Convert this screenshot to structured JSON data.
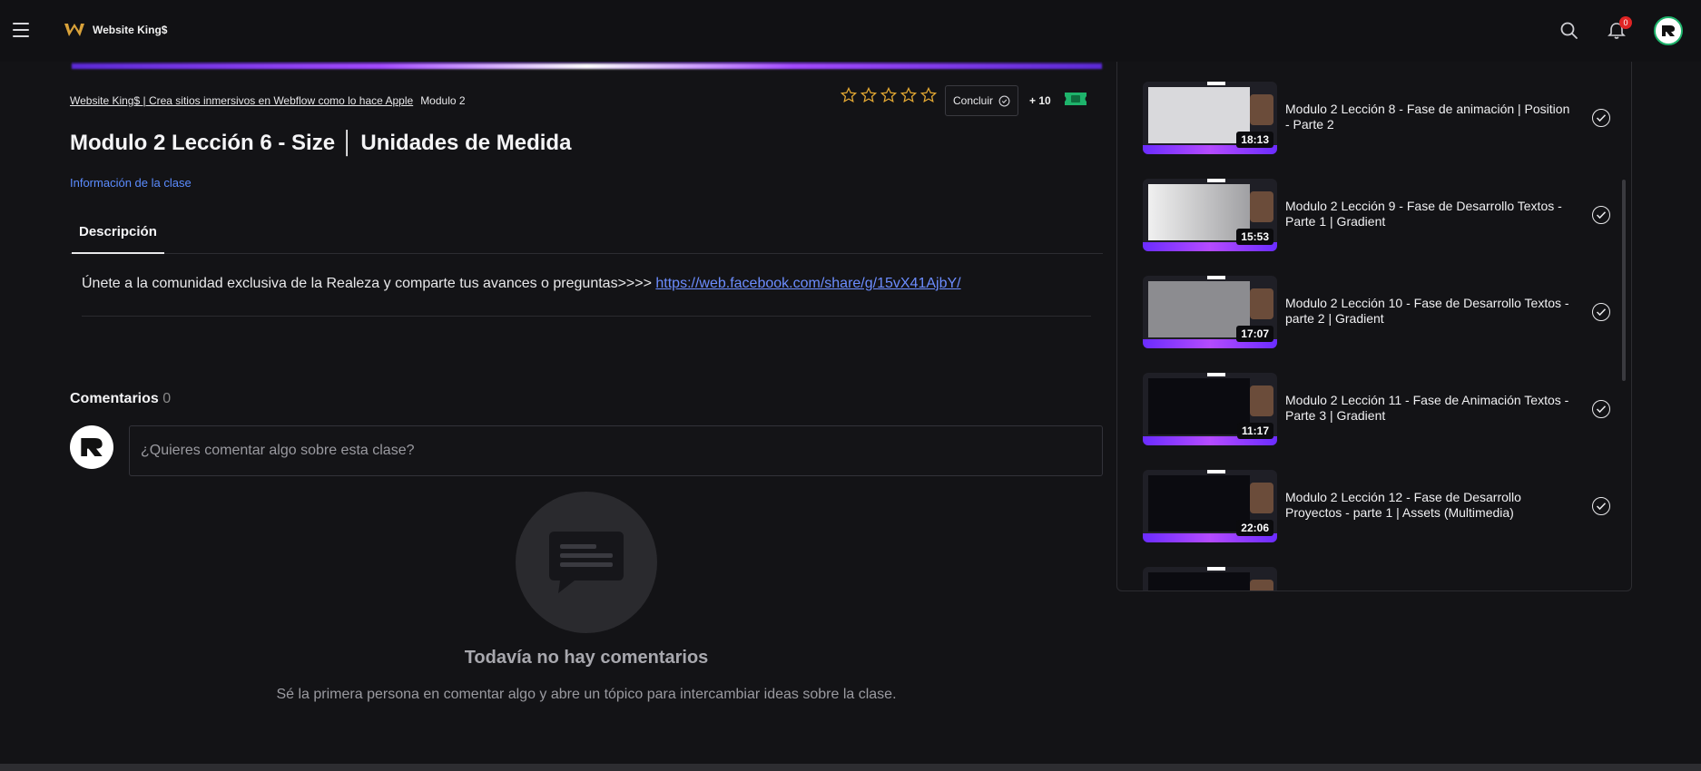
{
  "header": {
    "brand_name": "Website King$",
    "notification_count": "0",
    "icons": [
      "menu-icon",
      "search-icon",
      "bell-icon",
      "avatar"
    ]
  },
  "breadcrumb": {
    "course": "Website King$ | Crea sitios inmersivos en Webflow como lo hace Apple",
    "module": "Modulo 2"
  },
  "rating": {
    "stars": 5,
    "filled": 0
  },
  "actions": {
    "conclude_label": "Concluir",
    "points": "+ 10"
  },
  "lesson": {
    "title": "Modulo 2 Lección 6 - Size │ Unidades de Medida",
    "class_info": "Información de la clase"
  },
  "tabs": {
    "description": "Descripción"
  },
  "description": {
    "text": "Únete a la comunidad exclusiva de la Realeza y comparte tus avances o preguntas>>>> ",
    "link": "https://web.facebook.com/share/g/15vX41AjbY/"
  },
  "comments": {
    "heading": "Comentarios",
    "count": "0",
    "placeholder": "¿Quieres comentar algo sobre esta clase?",
    "empty_title": "Todavía no hay comentarios",
    "empty_subtitle": "Sé la primera persona en comentar algo y abre un tópico para intercambiar ideas sobre la clase."
  },
  "playlist": {
    "items": [
      {
        "title": "Modulo 2 Lección 8 - Fase de animación | Position - Parte 2",
        "duration": "18:13",
        "completed": true
      },
      {
        "title": "Modulo 2 Lección 9 - Fase de Desarrollo Textos - Parte 1 | Gradient",
        "duration": "15:53",
        "completed": true
      },
      {
        "title": "Modulo 2 Lección 10 - Fase de Desarrollo Textos - parte 2 | Gradient",
        "duration": "17:07",
        "completed": true
      },
      {
        "title": "Modulo 2 Lección 11 - Fase de Animación Textos - Parte 3 | Gradient",
        "duration": "11:17",
        "completed": true
      },
      {
        "title": "Modulo 2 Lección 12 - Fase de Desarrollo Proyectos - parte 1 | Assets (Multimedia)",
        "duration": "22:06",
        "completed": true
      }
    ]
  },
  "colors": {
    "background": "#131316",
    "link": "#6c8dff",
    "accent_purple": "#8a3dff",
    "badge_red": "#e02424",
    "ticket_green": "#1eb36b"
  }
}
